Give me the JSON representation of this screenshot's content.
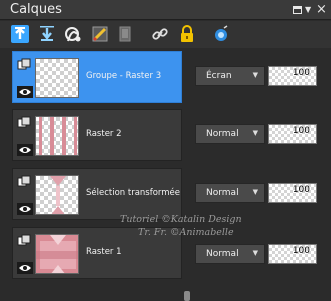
{
  "window": {
    "title": "Calques"
  },
  "toolbar": {
    "tools": [
      "new-layer-icon",
      "new-adjustment-layer-icon",
      "new-mask-icon",
      "brush-edit-icon",
      "delete-layer-icon",
      "link-icon",
      "lock-icon",
      "blend-icon"
    ]
  },
  "layers": [
    {
      "name": "Groupe - Raster 3",
      "blend": "Écran",
      "opacity": "100",
      "selected": true
    },
    {
      "name": "Raster 2",
      "blend": "Normal",
      "opacity": "100",
      "selected": false
    },
    {
      "name": "Sélection transformée",
      "blend": "Normal",
      "opacity": "100",
      "selected": false
    },
    {
      "name": "Raster 1",
      "blend": "Normal",
      "opacity": "100",
      "selected": false
    }
  ],
  "watermark": {
    "line1": "Tutoriel ©Katalin Design",
    "line2": "Tr. Fr. ©Animabelle"
  },
  "colors": {
    "selected": "#3d93ef",
    "panel": "#2b2b2b",
    "accent_pink": "#e0a1ab"
  }
}
